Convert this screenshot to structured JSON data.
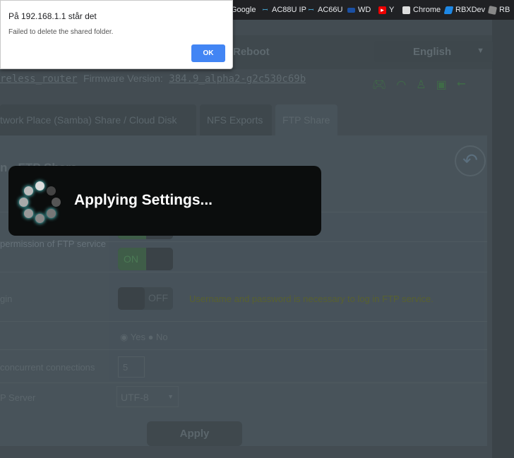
{
  "bookmarks": [
    {
      "label": "Google",
      "icon": "google-icon"
    },
    {
      "label": "AC88U IP",
      "icon": "wifi-antenna-icon"
    },
    {
      "label": "AC66U",
      "icon": "wifi-antenna-icon"
    },
    {
      "label": "WD",
      "icon": "wd-icon"
    },
    {
      "label": "Y",
      "icon": "youtube-icon"
    },
    {
      "label": "Chrome",
      "icon": "chrome-store-icon"
    },
    {
      "label": "RBXDev",
      "icon": "rbxdev-icon"
    },
    {
      "label": "RB",
      "icon": "roblox-icon"
    }
  ],
  "header": {
    "reboot": "Reboot",
    "language": "English",
    "firmware_prefix": "reless_router",
    "firmware_label": "Firmware Version:",
    "firmware_version": "384.9_alpha2-g2c530c69b"
  },
  "tabs": [
    {
      "label": "twork Place (Samba) Share / Cloud Disk",
      "active": false
    },
    {
      "label": "NFS Exports",
      "active": false
    },
    {
      "label": "FTP Share",
      "active": true
    }
  ],
  "section": {
    "title": "n - FTP Share",
    "desc": "permission of FTP service",
    "rows": [
      {
        "label": "",
        "toggle": "ON"
      },
      {
        "label": "",
        "toggle": "ON"
      },
      {
        "label": "gin",
        "toggle": "OFF",
        "hint": "Username and password is necessary to log in FTP service."
      },
      {
        "label": "",
        "radio_yes": "Yes",
        "radio_no": "No",
        "selected": "Yes"
      },
      {
        "label": "concurrent connections",
        "value": "5"
      },
      {
        "label": "P Server",
        "select": "UTF-8"
      }
    ],
    "apply": "Apply"
  },
  "dialog": {
    "title": "På 192.168.1.1 står det",
    "message": "Failed to delete the shared folder.",
    "ok": "OK",
    "ok_color": "#4285f4"
  },
  "loader": {
    "text": "Applying Settings..."
  }
}
